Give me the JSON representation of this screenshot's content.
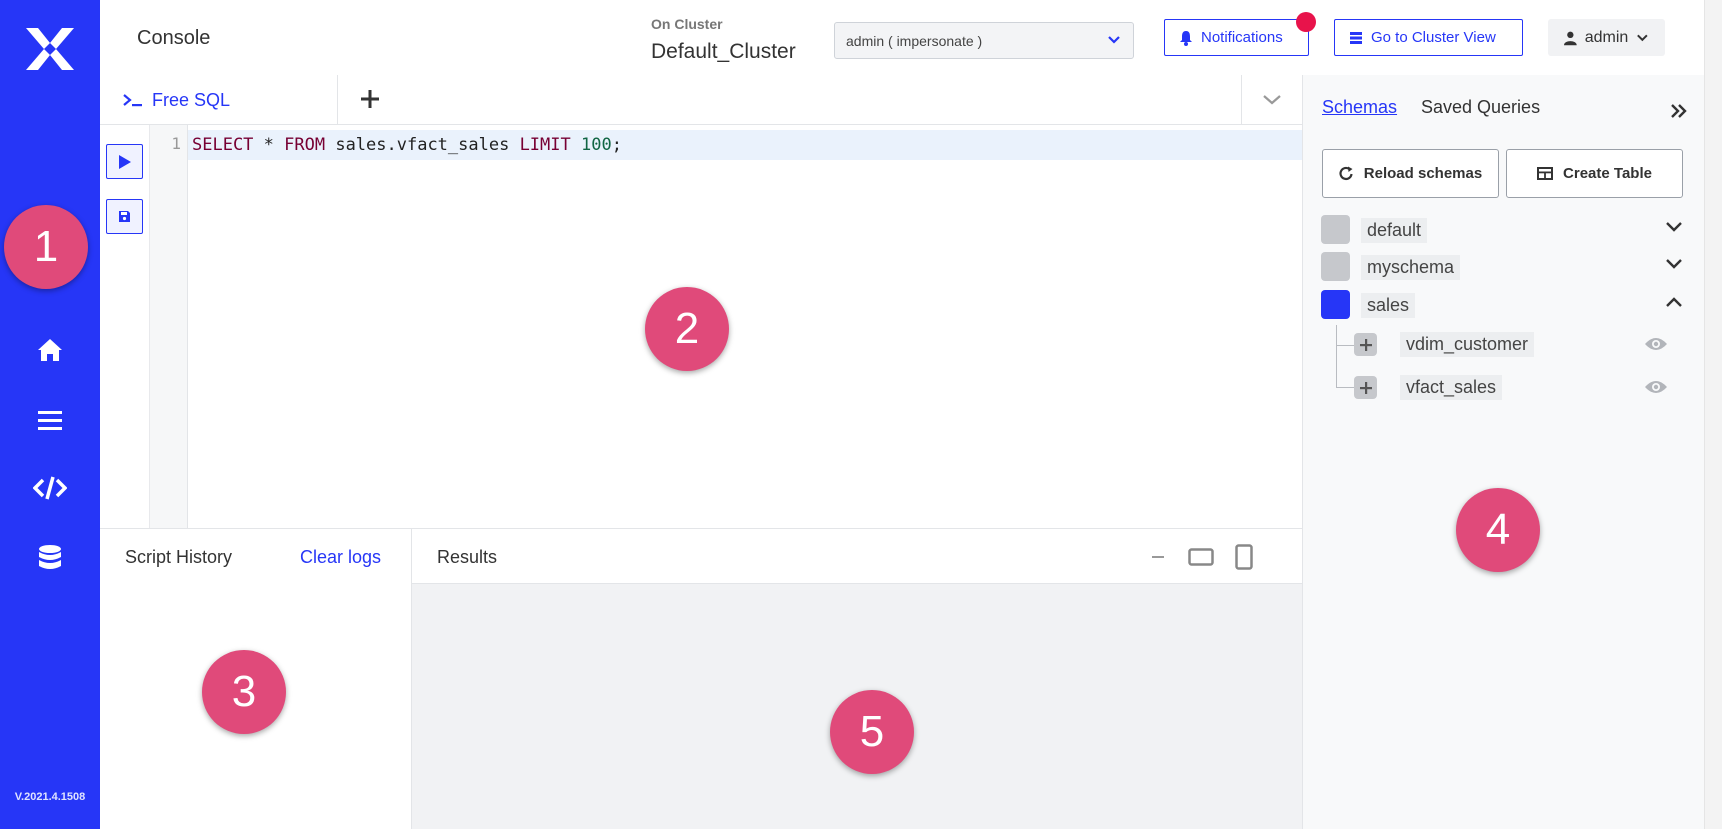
{
  "sidebar": {
    "version": "V.2021.4.1508",
    "icons": [
      "home-icon",
      "menu-icon",
      "code-icon",
      "database-icon"
    ]
  },
  "header": {
    "title": "Console",
    "on_cluster_label": "On Cluster",
    "cluster_name": "Default_Cluster",
    "user_select_value": "admin ( impersonate )",
    "notifications_label": "Notifications",
    "cluster_view_label": "Go to Cluster View",
    "admin_label": "admin"
  },
  "tabs": {
    "free_sql_label": "Free SQL"
  },
  "editor": {
    "line_number": "1",
    "tokens": {
      "select": "SELECT",
      "star": " * ",
      "from": "FROM",
      "table": " sales.vfact_sales ",
      "limit": "LIMIT",
      "space": " ",
      "num": "100",
      "end": ";"
    }
  },
  "history": {
    "title": "Script History",
    "clear_label": "Clear logs"
  },
  "results": {
    "title": "Results"
  },
  "schema_panel": {
    "tab_schemas": "Schemas",
    "tab_saved": "Saved Queries",
    "reload_label": "Reload schemas",
    "create_table_label": "Create Table",
    "schemas": [
      {
        "name": "default",
        "expanded": false
      },
      {
        "name": "myschema",
        "expanded": false
      },
      {
        "name": "sales",
        "expanded": true
      }
    ],
    "tables": [
      "vdim_customer",
      "vfact_sales"
    ]
  },
  "callouts": [
    "1",
    "2",
    "3",
    "4",
    "5"
  ],
  "colors": {
    "brand": "#2636f7",
    "notification_dot": "#e8134b",
    "callout": "#e04a7a"
  }
}
